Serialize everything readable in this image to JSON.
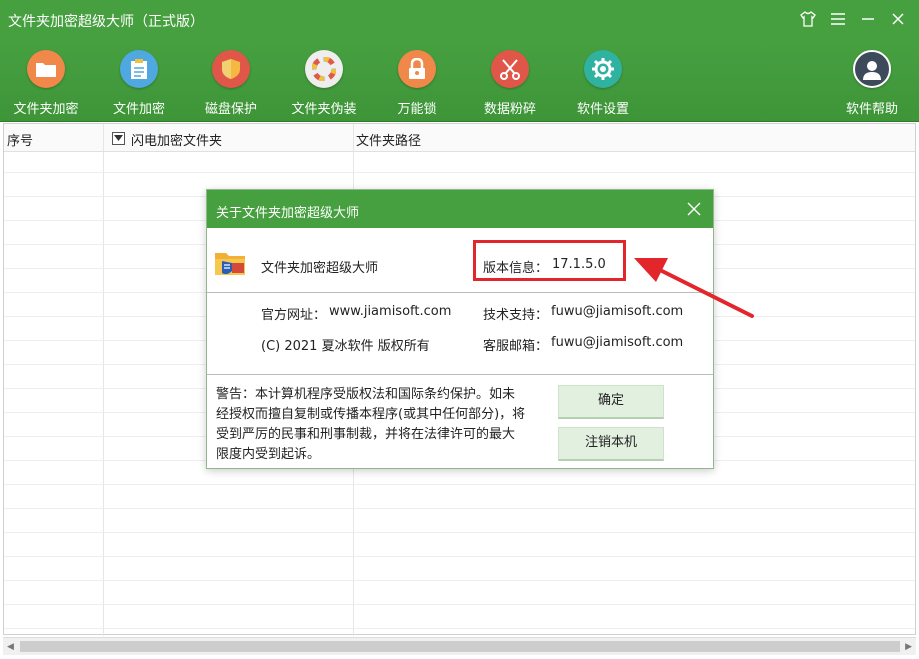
{
  "window": {
    "title": "文件夹加密超级大师（正式版）"
  },
  "window_controls": [
    "skin",
    "menu",
    "minimize",
    "close"
  ],
  "toolbar": {
    "items": [
      {
        "label": "文件夹加密",
        "icon": "folder-icon",
        "color": "#f0884a"
      },
      {
        "label": "文件加密",
        "icon": "clipboard-icon",
        "color": "#4fa8e0"
      },
      {
        "label": "磁盘保护",
        "icon": "shield-icon",
        "color": "#e0574a"
      },
      {
        "label": "文件夹伪装",
        "icon": "color-wheel-icon",
        "color": "#eeeeee"
      },
      {
        "label": "万能锁",
        "icon": "lock-icon",
        "color": "#f0884a"
      },
      {
        "label": "数据粉碎",
        "icon": "scissors-icon",
        "color": "#e0574a"
      },
      {
        "label": "软件设置",
        "icon": "gear-icon",
        "color": "#2fb3a0"
      },
      {
        "label": "软件帮助",
        "icon": "user-icon",
        "color": "#3c4a5c"
      }
    ]
  },
  "table": {
    "columns": [
      "序号",
      "闪电加密文件夹",
      "文件夹路径"
    ],
    "rows": []
  },
  "dialog": {
    "title": "关于文件夹加密超级大师",
    "product_name": "文件夹加密超级大师",
    "version_label": "版本信息：",
    "version_value": "17.1.5.0",
    "website_label": "官方网址：",
    "website_value": "www.jiamisoft.com",
    "support_label": "技术支持：",
    "support_value": "fuwu@jiamisoft.com",
    "copyright": "(C) 2021 夏冰软件 版权所有",
    "service_email_label": "客服邮箱：",
    "service_email_value": "fuwu@jiamisoft.com",
    "warning": "警告：本计算机程序受版权法和国际条约保护。如未经授权而擅自复制或传播本程序(或其中任何部分)，将受到严厉的民事和刑事制裁，并将在法律许可的最大限度内受到起诉。",
    "ok_button": "确定",
    "deregister_button": "注销本机"
  },
  "annotation": {
    "highlight_color": "#e3262b"
  }
}
